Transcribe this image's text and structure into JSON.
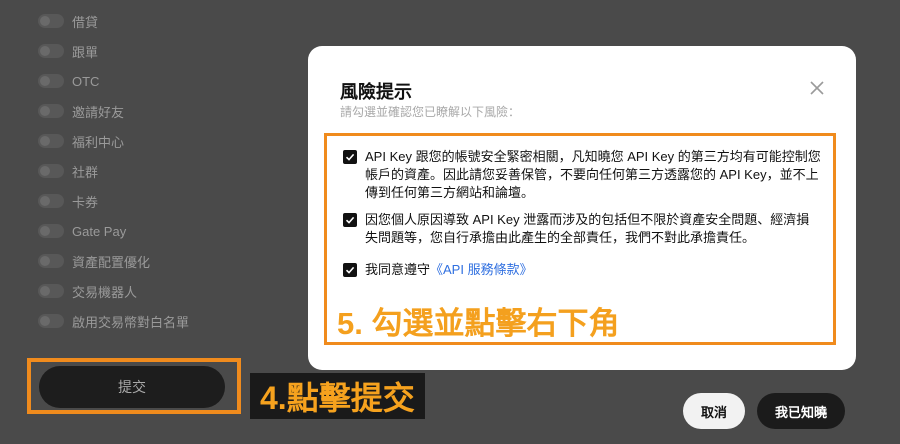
{
  "permissions": [
    {
      "label": "借貸"
    },
    {
      "label": "跟單"
    },
    {
      "label": "OTC"
    },
    {
      "label": "邀請好友"
    },
    {
      "label": "福利中心"
    },
    {
      "label": "社群"
    },
    {
      "label": "卡券"
    },
    {
      "label": "Gate Pay"
    },
    {
      "label": "資產配置優化"
    },
    {
      "label": "交易機器人"
    },
    {
      "label": "啟用交易幣對白名單"
    }
  ],
  "submit_label": "提交",
  "annotations": {
    "step4": "4.點擊提交",
    "step5": "5. 勾選並點擊右下角"
  },
  "modal": {
    "title": "風險提示",
    "subtitle": "請勾選並確認您已瞭解以下風險：",
    "items": [
      {
        "text": "API Key 跟您的帳號安全緊密相關，凡知曉您 API Key 的第三方均有可能控制您帳戶的資產。因此請您妥善保管，不要向任何第三方透露您的 API Key，並不上傳到任何第三方網站和論壇。",
        "checked": true
      },
      {
        "text": "因您個人原因導致 API Key 泄露而涉及的包括但不限於資產安全問題、經濟損失問題等，您自行承擔由此產生的全部責任，我們不對此承擔責任。",
        "checked": true
      },
      {
        "text": "我同意遵守",
        "link": "《API 服務條款》",
        "checked": true
      }
    ],
    "cancel_label": "取消",
    "confirm_label": "我已知曉"
  },
  "colors": {
    "highlight": "#f08b1d",
    "link": "#2f6fe0"
  }
}
